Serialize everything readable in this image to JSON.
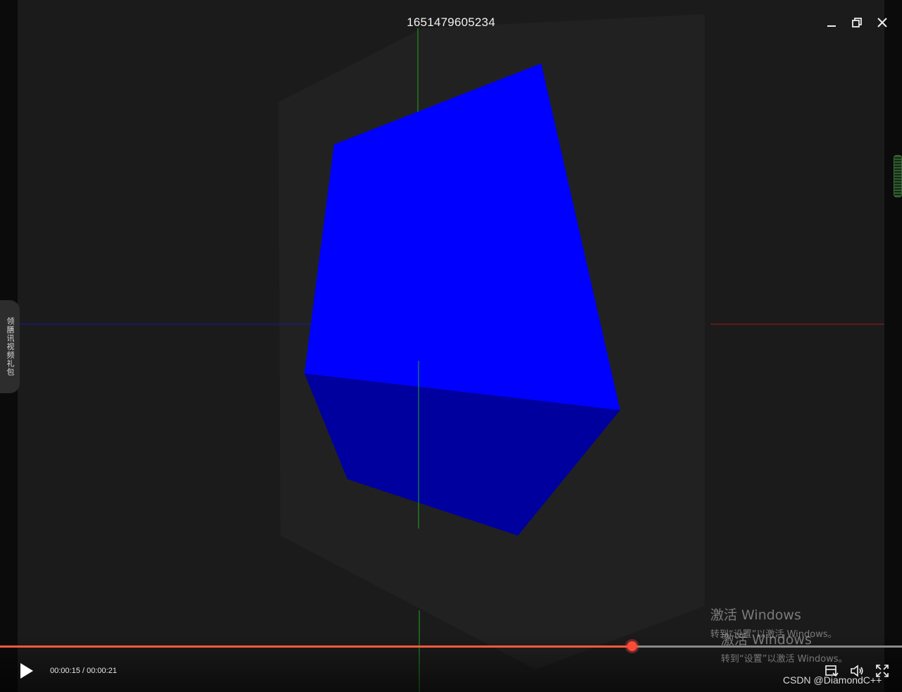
{
  "window": {
    "title": "1651479605234"
  },
  "side_tab": {
    "label": "领膳讯视频礼包"
  },
  "watermarks": [
    {
      "title": "激活 Windows",
      "subtitle": "转到“设置”以激活 Windows。"
    },
    {
      "title": "激活 Windows",
      "subtitle": "转到“设置”以激活 Windows。"
    }
  ],
  "player": {
    "current_time": "00:00:15",
    "total_time": "00:00:21",
    "separator": " / ",
    "progress": 0.701
  },
  "credit": "CSDN @DiamondC++",
  "colors": {
    "progress": "#ff5a3c",
    "cube_front": "#0000ff",
    "cube_bottom": "#00009e",
    "axis_y": "#1fa81f",
    "axis_x_neg": "#1a1aa0",
    "axis_x_pos": "#a01a1a"
  },
  "icons": {
    "minimize": "minimize-icon",
    "restore": "restore-icon",
    "close": "close-icon",
    "play": "play-icon",
    "playlist": "playlist-icon",
    "volume": "volume-icon",
    "fullscreen": "fullscreen-icon"
  }
}
